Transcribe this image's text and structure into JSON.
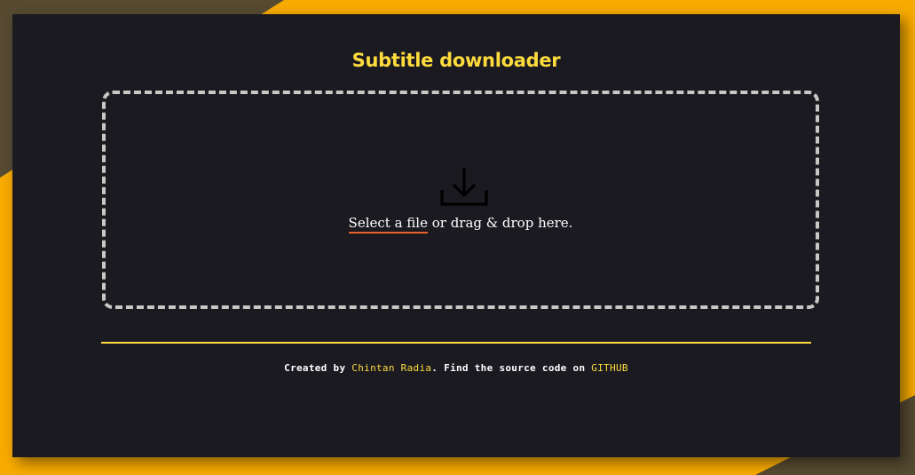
{
  "page": {
    "title": "Subtitle downloader"
  },
  "dropzone": {
    "select_label": "Select a file",
    "rest_label": " or drag & drop here.",
    "icon": "download-icon"
  },
  "footer": {
    "prefix": "Created by ",
    "author": "Chintan Radia",
    "middle": ". Find the source code on ",
    "github": "GITHUB"
  },
  "colors": {
    "background": "#f7aa00",
    "card": "#1b1a21",
    "accent": "#fedc3d",
    "link_underline": "#e8622a",
    "dash_border": "#c8c8c4"
  }
}
